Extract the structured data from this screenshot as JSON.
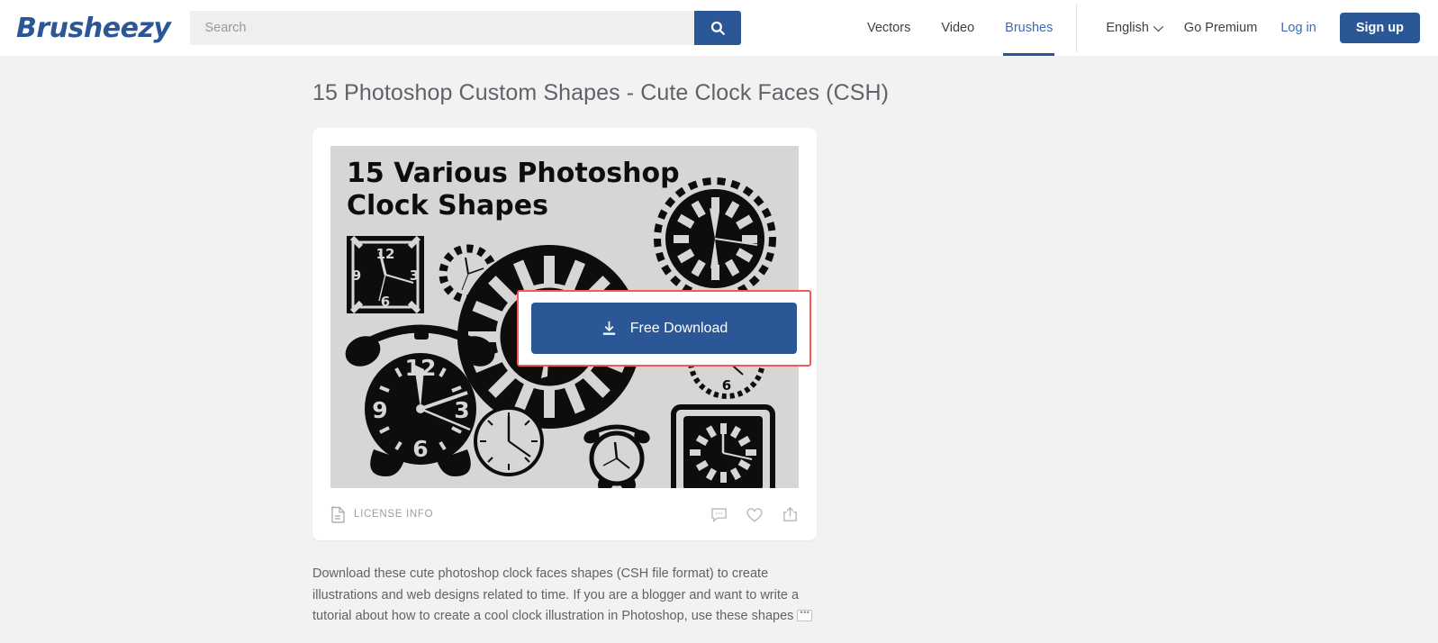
{
  "header": {
    "logo": "Brusheezy",
    "search": {
      "placeholder": "Search",
      "value": "",
      "icon": "search-icon"
    },
    "categories": [
      {
        "label": "Vectors",
        "active": false
      },
      {
        "label": "Video",
        "active": false
      },
      {
        "label": "Brushes",
        "active": true
      }
    ],
    "language": {
      "label": "English",
      "icon": "chevron-down-icon"
    },
    "go_premium": "Go Premium",
    "log_in": "Log in",
    "sign_up": "Sign up"
  },
  "main": {
    "page_title": "15 Photoshop Custom Shapes - Cute Clock Faces (CSH)",
    "preview": {
      "heading_line1": "15 Various Photoshop",
      "heading_line2": "Clock Shapes",
      "numerals": [
        "12",
        "3",
        "6",
        "9"
      ],
      "background_color": "#d6d6d6",
      "ink_color": "#0d0d0d"
    },
    "license": {
      "label": "LICENSE INFO",
      "icon": "document-icon"
    },
    "actions": [
      {
        "name": "comment-icon",
        "label": "Comment"
      },
      {
        "name": "heart-icon",
        "label": "Favorite"
      },
      {
        "name": "share-icon",
        "label": "Share"
      }
    ],
    "description": "Download these cute photoshop clock faces shapes (CSH file format) to create illustrations and web designs related to time. If you are a blogger and want to write a tutorial about how to create a cool clock illustration in Photoshop, use these shapes",
    "description_more": "…"
  },
  "download": {
    "label": "Free Download",
    "icon": "download-icon",
    "highlight_color": "#f9565a",
    "button_color": "#2b5797"
  },
  "colors": {
    "brand_blue": "#2b5797",
    "link_blue": "#3d6bb3",
    "page_bg": "#f2f2f2",
    "text_gray": "#5f6368"
  }
}
